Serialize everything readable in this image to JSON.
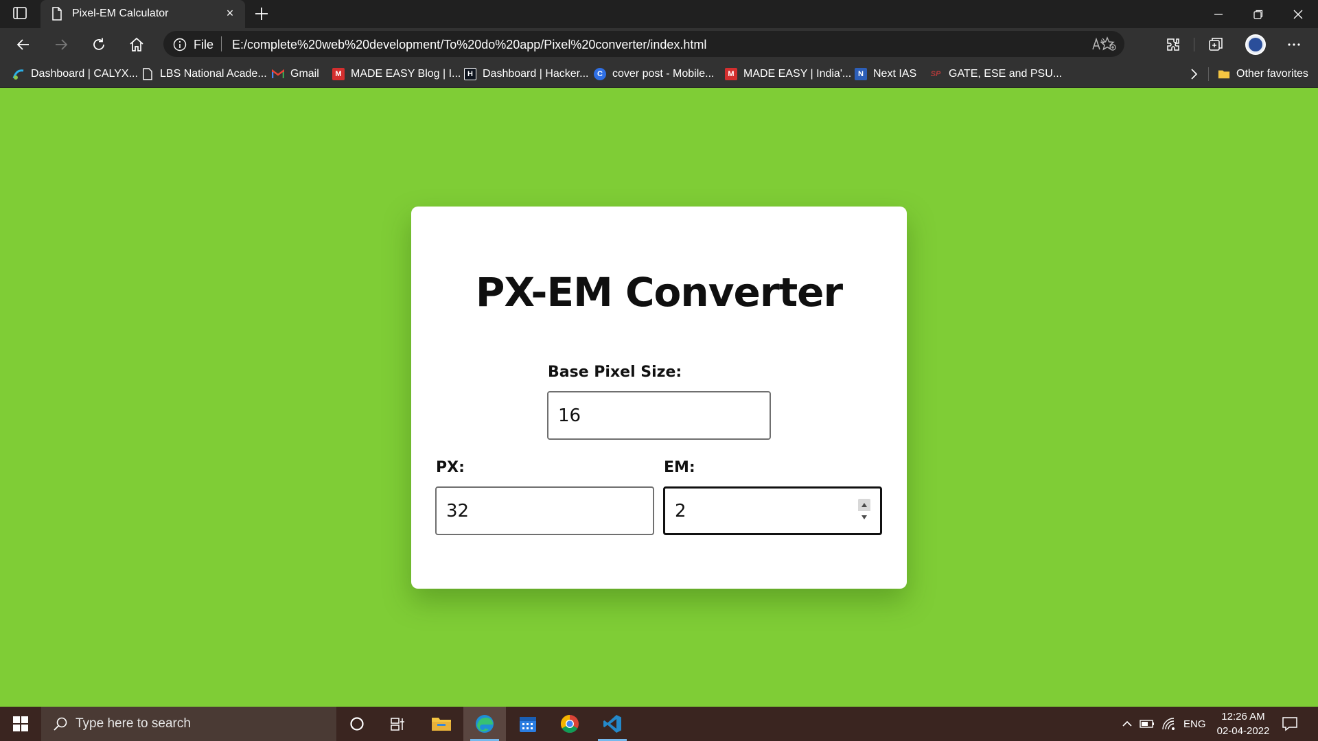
{
  "browser": {
    "tab_title": "Pixel-EM Calculator",
    "tab_close": "×",
    "scheme_label": "File",
    "url": "E:/complete%20web%20development/To%20do%20app/Pixel%20converter/index.html"
  },
  "favorites": {
    "items": [
      {
        "label": "Dashboard | CALYX...",
        "icon": "calyx-icon",
        "color": "#2bb0e8"
      },
      {
        "label": "LBS National Acade...",
        "icon": "page-icon",
        "color": "#ffffff"
      },
      {
        "label": "Gmail",
        "icon": "gmail-icon",
        "color": "#ea4335"
      },
      {
        "label": "MADE EASY Blog | I...",
        "icon": "made-easy-icon",
        "color": "#d32f2f"
      },
      {
        "label": "Dashboard | Hacker...",
        "icon": "hackerrank-icon",
        "color": "#0e141e"
      },
      {
        "label": "cover post - Mobile...",
        "icon": "canva-icon",
        "color": "#2f6fe4"
      },
      {
        "label": "MADE EASY | India'...",
        "icon": "made-easy-icon",
        "color": "#d32f2f"
      },
      {
        "label": "Next IAS",
        "icon": "next-ias-icon",
        "color": "#2d5fb8"
      },
      {
        "label": "GATE, ESE and PSU...",
        "icon": "sp-icon",
        "color": "#b03a3a"
      }
    ],
    "other_favorites": "Other favorites"
  },
  "app": {
    "title": "PX-EM Converter",
    "base_label": "Base Pixel Size:",
    "base_value": "16",
    "px_label": "PX:",
    "px_value": "32",
    "em_label": "EM:",
    "em_value": "2"
  },
  "taskbar": {
    "search_placeholder": "Type here to search",
    "language": "ENG",
    "time": "12:26 AM",
    "date": "02-04-2022"
  },
  "colors": {
    "page_background": "#7fcd36",
    "card_background": "#ffffff",
    "browser_chrome": "#323232"
  }
}
